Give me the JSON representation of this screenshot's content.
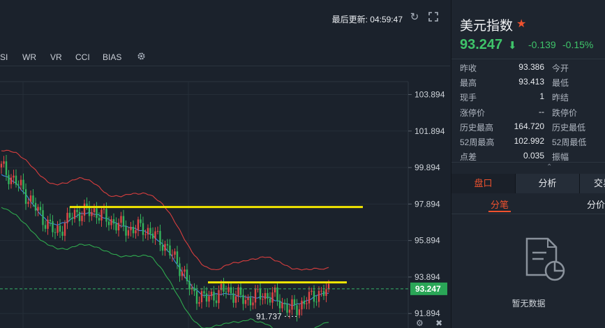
{
  "header": {
    "update_label": "最后更新: 04:59:47",
    "refresh_icon": "refresh-icon",
    "fullscreen_icon": "fullscreen-icon"
  },
  "indicator_tabs": [
    "SI",
    "WR",
    "VR",
    "CCI",
    "BIAS"
  ],
  "settings_icon": "gear-icon",
  "chart_data": {
    "type": "candlestick",
    "y_ticks": [
      "103.894",
      "101.894",
      "99.894",
      "97.894",
      "95.894",
      "93.894",
      "91.894"
    ],
    "ylim": [
      91.1,
      104.6
    ],
    "current_price_label": "93.247",
    "current_price": 93.247,
    "low_marker_label": "91.737",
    "low_marker_value": 91.737,
    "horizontal_levels": [
      97.73,
      93.6
    ],
    "colors": {
      "up": "#e04646",
      "down": "#34b45c",
      "level": "#f2e600",
      "mid": "#3f8ce6",
      "upper": "#d83e3e",
      "lower": "#2fa94e"
    }
  },
  "quote": {
    "name": "美元指数",
    "price": "93.247",
    "change": "-0.139",
    "change_pct": "-0.15%",
    "rows": [
      {
        "l1": "昨收",
        "v1": "93.386",
        "l2": "今开"
      },
      {
        "l1": "最高",
        "v1": "93.413",
        "l2": "最低"
      },
      {
        "l1": "现手",
        "v1": "1",
        "l2": "昨结"
      },
      {
        "l1": "涨停价",
        "v1": "--",
        "l2": "跌停价"
      },
      {
        "l1": "历史最高",
        "v1": "164.720",
        "l2": "历史最低"
      },
      {
        "l1": "52周最高",
        "v1": "102.992",
        "l2": "52周最低"
      },
      {
        "l1": "点差",
        "v1": "0.035",
        "l2": "振幅"
      }
    ],
    "tabs": [
      "盘口",
      "分析",
      "交易"
    ],
    "subtab_active": "分笔",
    "subtab_other": "分价",
    "empty_text": "暂无数据"
  },
  "colors": {
    "accent": "#f0522e",
    "green": "#3fc46a"
  }
}
